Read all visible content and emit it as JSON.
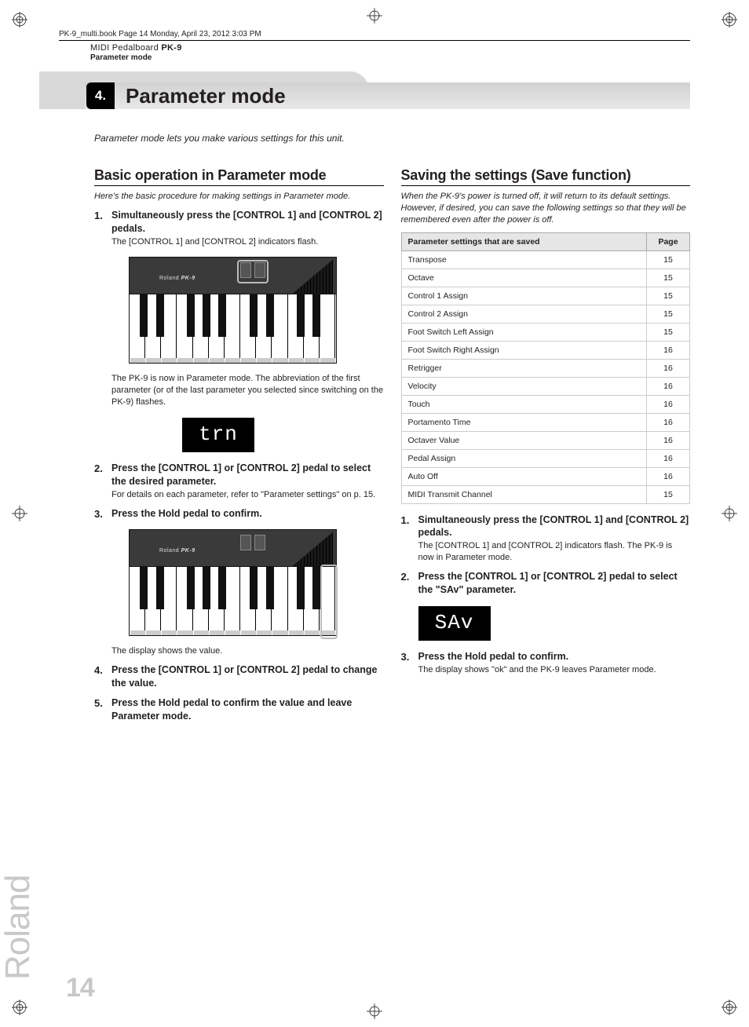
{
  "meta": {
    "crop_header": "PK-9_multi.book  Page 14  Monday, April 23, 2012  3:03 PM",
    "product_line": "MIDI Pedalboard ",
    "product_model": "PK-9",
    "section_label": "Parameter mode",
    "brand_side": "Roland",
    "page_number": "14"
  },
  "title": {
    "number": "4.",
    "text": "Parameter mode"
  },
  "intro": "Parameter mode lets you make various settings for this unit.",
  "left": {
    "heading": "Basic operation in Parameter mode",
    "intro": "Here's the basic procedure for making settings in Parameter mode.",
    "steps": [
      {
        "head": "Simultaneously press the [CONTROL 1] and [CONTROL 2] pedals.",
        "body": "The [CONTROL 1] and [CONTROL 2] indicators flash."
      },
      {
        "head": "Press the [CONTROL 1] or [CONTROL 2] pedal to select the desired parameter.",
        "body": "For details on each parameter, refer to \"Parameter settings\" on p. 15."
      },
      {
        "head": "Press the Hold pedal to confirm.",
        "body": ""
      },
      {
        "head": "Press the [CONTROL 1] or [CONTROL 2] pedal to change the value.",
        "body": ""
      },
      {
        "head": "Press the Hold pedal to confirm the value and leave Parameter mode.",
        "body": ""
      }
    ],
    "note_after_fig1": "The PK-9 is now in Parameter mode. The abbreviation of the first parameter (or of the last parameter you selected since switching on the PK-9) flashes.",
    "display1": "trn",
    "note_after_fig2": "The display shows the value.",
    "pedalboard_brand": "PK-9"
  },
  "right": {
    "heading": "Saving the settings (Save function)",
    "intro": "When the PK-9's power is turned off, it will return to its default settings. However, if desired, you can save the following settings so that they will be remembered even after the power is off.",
    "table_header_param": "Parameter settings that are saved",
    "table_header_page": "Page",
    "table": [
      {
        "name": "Transpose",
        "page": "15"
      },
      {
        "name": "Octave",
        "page": "15"
      },
      {
        "name": "Control 1 Assign",
        "page": "15"
      },
      {
        "name": "Control 2 Assign",
        "page": "15"
      },
      {
        "name": "Foot Switch Left Assign",
        "page": "15"
      },
      {
        "name": "Foot Switch Right Assign",
        "page": "16"
      },
      {
        "name": "Retrigger",
        "page": "16"
      },
      {
        "name": "Velocity",
        "page": "16"
      },
      {
        "name": "Touch",
        "page": "16"
      },
      {
        "name": "Portamento Time",
        "page": "16"
      },
      {
        "name": "Octaver Value",
        "page": "16"
      },
      {
        "name": "Pedal Assign",
        "page": "16"
      },
      {
        "name": "Auto Off",
        "page": "16"
      },
      {
        "name": "MIDI Transmit Channel",
        "page": "15"
      }
    ],
    "steps": [
      {
        "head": "Simultaneously press the [CONTROL 1] and [CONTROL 2] pedals.",
        "body": "The [CONTROL 1] and [CONTROL 2] indicators flash. The PK-9 is now in Parameter mode."
      },
      {
        "head": "Press the [CONTROL 1] or [CONTROL 2] pedal to select the \"SAv\" parameter.",
        "body": ""
      },
      {
        "head": "Press the Hold pedal to confirm.",
        "body": "The display shows \"ok\" and the PK-9 leaves Parameter mode."
      }
    ],
    "display": "SAv"
  }
}
